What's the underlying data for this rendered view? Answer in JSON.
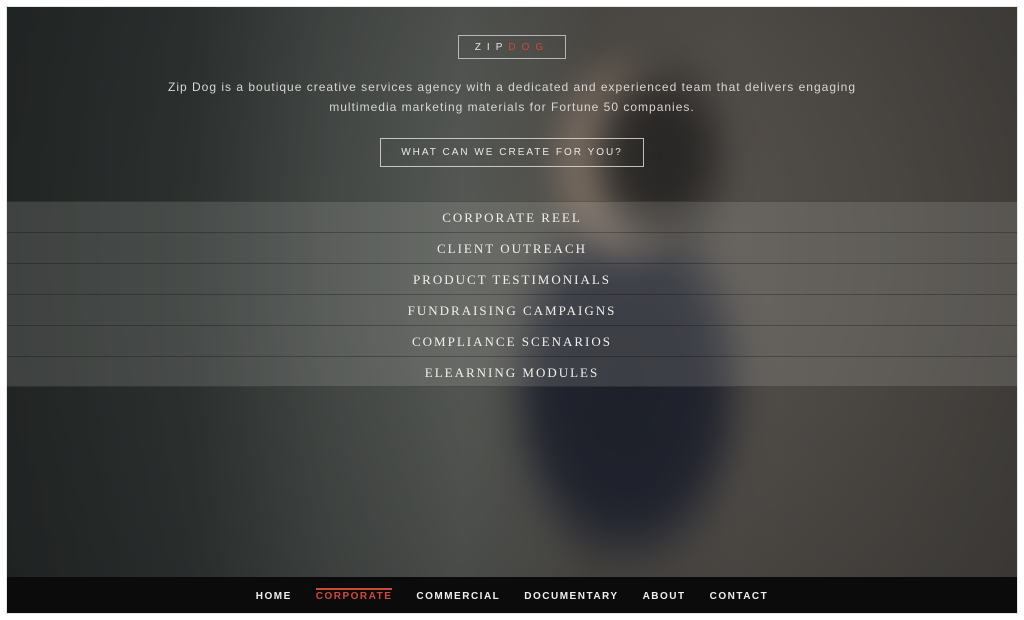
{
  "brand": {
    "part1": "ZIP",
    "part2": "DOG"
  },
  "tagline": "Zip Dog is a boutique creative services agency with a dedicated and experienced team that delivers engaging multimedia marketing materials for Fortune 50 companies.",
  "cta_label": "WHAT CAN WE CREATE FOR YOU?",
  "services": [
    "CORPORATE REEL",
    "CLIENT OUTREACH",
    "PRODUCT TESTIMONIALS",
    "FUNDRAISING CAMPAIGNS",
    "COMPLIANCE SCENARIOS",
    "ELEARNING MODULES"
  ],
  "nav": {
    "items": [
      "HOME",
      "CORPORATE",
      "COMMERCIAL",
      "DOCUMENTARY",
      "ABOUT",
      "CONTACT"
    ],
    "active_index": 1
  },
  "colors": {
    "accent": "#cc4a3a"
  }
}
